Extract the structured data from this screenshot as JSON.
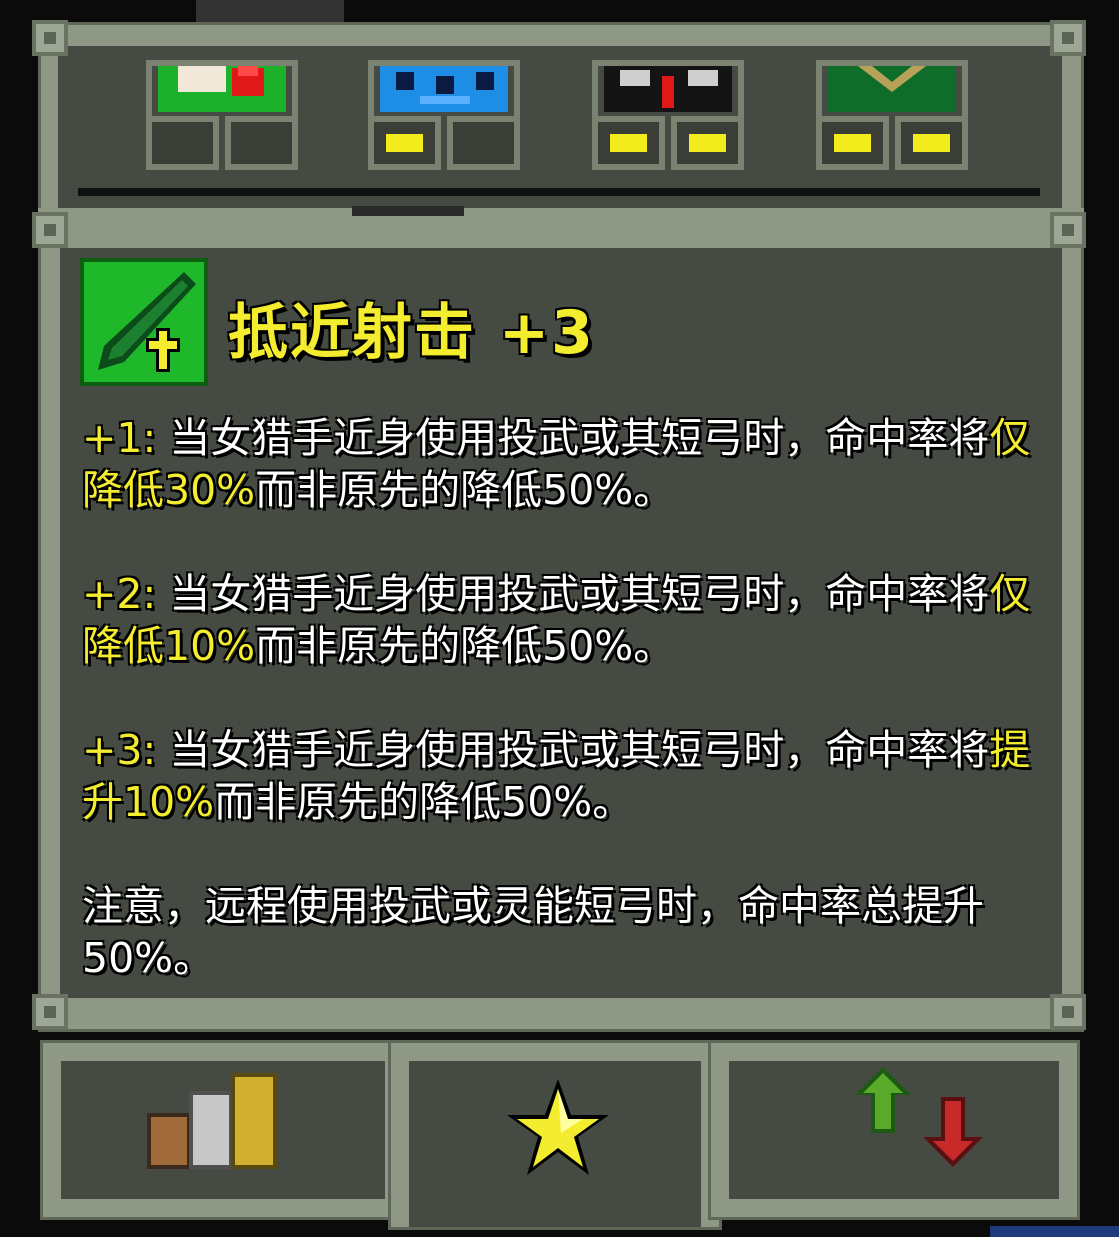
{
  "talent": {
    "title": "抵近射击 +3",
    "icon": "green-dagger-plus-icon"
  },
  "description": [
    {
      "prefix": "+1:",
      "text_a": "当女猎手近身使用投武或其短弓时，命中率将",
      "highlight": "仅降低30%",
      "text_b": "而非原先的降低50%。"
    },
    {
      "prefix": "+2:",
      "text_a": "当女猎手近身使用投武或其短弓时，命中率将",
      "highlight": "仅降低10%",
      "text_b": "而非原先的降低50%。"
    },
    {
      "prefix": "+3:",
      "text_a": "当女猎手近身使用投武或其短弓时，命中率将",
      "highlight": "提升10%",
      "text_b": "而非原先的降低50%。"
    }
  ],
  "note": "注意，远程使用投武或灵能短弓时，命中率总提升50%。",
  "top_slots": [
    {
      "icon": "warrior-portrait-icon",
      "filled": [
        false,
        false
      ]
    },
    {
      "icon": "mage-portrait-icon",
      "filled": [
        true,
        false
      ]
    },
    {
      "icon": "rogue-portrait-icon",
      "filled": [
        true,
        true
      ]
    },
    {
      "icon": "huntress-portrait-icon",
      "filled": [
        true,
        true
      ]
    }
  ],
  "tabs": [
    {
      "icon": "stats-bars-icon"
    },
    {
      "icon": "star-icon"
    },
    {
      "icon": "up-down-arrows-icon"
    }
  ],
  "colors": {
    "highlight": "#f4ec2e",
    "text": "#ffffff",
    "panel": "#454a42",
    "frame": "#8e9884"
  }
}
